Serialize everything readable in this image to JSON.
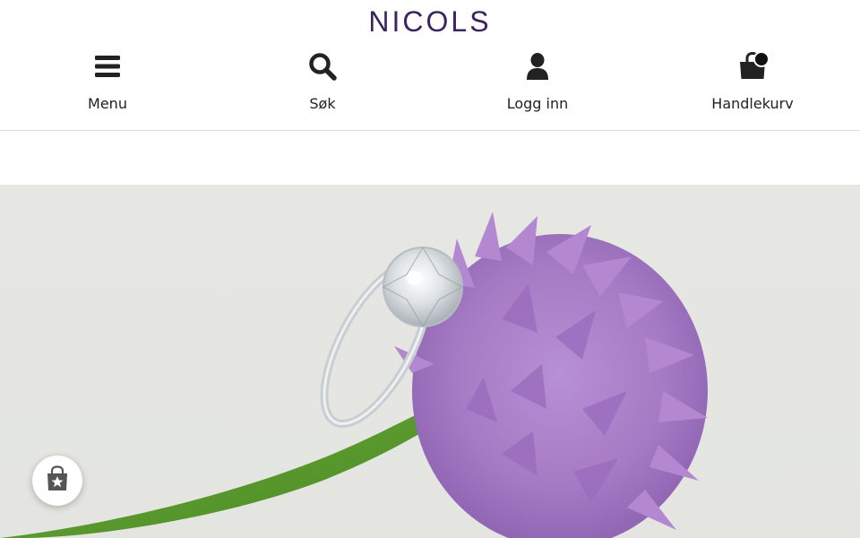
{
  "header": {
    "logo_text": "NICOLS"
  },
  "nav": {
    "items": [
      {
        "label": "Menu",
        "icon": "hamburger-menu-icon"
      },
      {
        "label": "Søk",
        "icon": "search-icon"
      },
      {
        "label": "Logg inn",
        "icon": "user-icon"
      },
      {
        "label": "Handlekurv",
        "icon": "shopping-bag-icon"
      }
    ]
  },
  "hero": {
    "image": "engagement ring on purple flower"
  },
  "colors": {
    "brand": "#3b2560",
    "hero_background": "#e5e6e1",
    "flower_purple": "#a97cc6",
    "stem_green": "#5d9a2f"
  },
  "floating": {
    "icon": "reviews-badge-icon"
  }
}
